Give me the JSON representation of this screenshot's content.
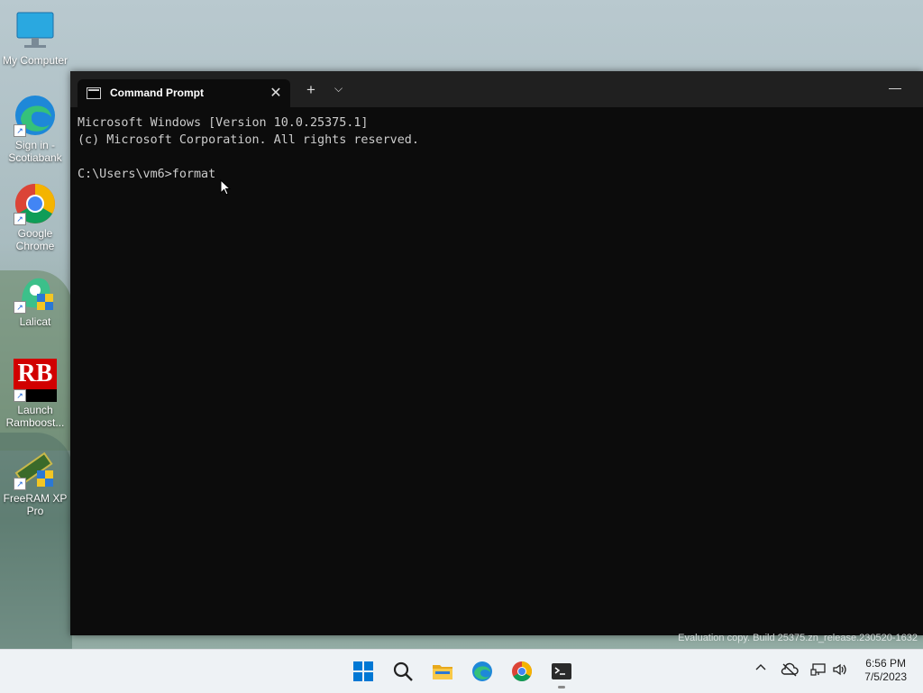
{
  "desktop": {
    "icons": [
      {
        "label_line1": "My Computer",
        "label_line2": "",
        "icon": "monitor-icon"
      },
      {
        "label_line1": "Sign in -",
        "label_line2": "Scotiabank",
        "icon": "edge-icon"
      },
      {
        "label_line1": "Google",
        "label_line2": "Chrome",
        "icon": "chrome-icon"
      },
      {
        "label_line1": "Lalicat",
        "label_line2": "",
        "icon": "lalicat-icon"
      },
      {
        "label_line1": "Launch",
        "label_line2": "Ramboost...",
        "icon": "ramboost-icon",
        "logo_text": "RB"
      },
      {
        "label_line1": "FreeRAM XP",
        "label_line2": "Pro",
        "icon": "freeram-icon"
      }
    ],
    "watermark": "Evaluation copy. Build 25375.zn_release.230520-1632"
  },
  "terminal": {
    "tab_title": "Command Prompt",
    "tab_close": "✕",
    "new_tab": "+",
    "dropdown": "⌵",
    "minimize": "—",
    "lines": [
      "Microsoft Windows [Version 10.0.25375.1]",
      "(c) Microsoft Corporation. All rights reserved.",
      "",
      "C:\\Users\\vm6>format"
    ]
  },
  "taskbar": {
    "apps": [
      "start-icon",
      "search-icon",
      "file-explorer-icon",
      "edge-icon",
      "chrome-icon",
      "terminal-icon"
    ],
    "tray": {
      "chevron": "^",
      "time": "6:56 PM",
      "date": "7/5/2023"
    }
  },
  "colors": {
    "terminal_bg": "#0c0c0c",
    "titlebar_bg": "#202020",
    "console_text": "#cccccc",
    "taskbar_bg": "#eef2f5",
    "accent_blue": "#0078d4"
  }
}
